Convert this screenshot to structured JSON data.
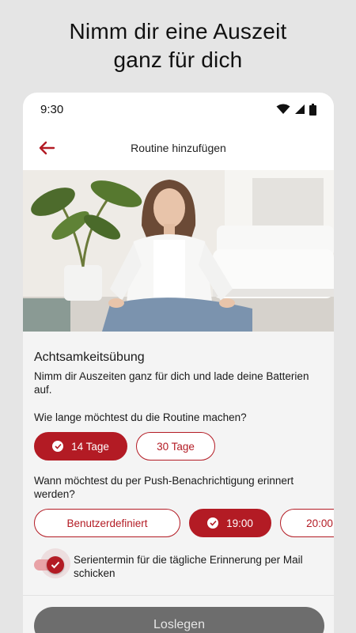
{
  "headline": {
    "line1": "Nimm dir eine Auszeit",
    "line2": "ganz für dich"
  },
  "status_bar": {
    "time": "9:30",
    "icons": [
      "wifi-icon",
      "cell-signal-icon",
      "battery-icon"
    ]
  },
  "app_bar": {
    "title": "Routine hinzufügen",
    "back_icon": "arrow-left-icon"
  },
  "routine": {
    "title": "Achtsamkeitsübung",
    "description": "Nimm dir Auszeiten ganz für dich und lade deine Batterien auf."
  },
  "duration": {
    "question": "Wie lange möchtest du die Routine machen?",
    "options": [
      {
        "label": "14 Tage",
        "selected": true
      },
      {
        "label": "30 Tage",
        "selected": false
      }
    ]
  },
  "reminder": {
    "question": "Wann möchtest du per Push-Benachrichtigung erinnert werden?",
    "options": [
      {
        "label": "Benutzerdefiniert",
        "selected": false
      },
      {
        "label": "19:00",
        "selected": true
      },
      {
        "label": "20:00",
        "selected": false
      }
    ]
  },
  "mail_toggle": {
    "label": "Serientermin für die tägliche Erinnerung per Mail schicken",
    "checked": true
  },
  "cta": {
    "label": "Loslegen"
  },
  "colors": {
    "accent": "#b31b24",
    "cta_disabled": "#6d6d6d",
    "background": "#e5e5e5",
    "surface": "#f4f4f4"
  }
}
